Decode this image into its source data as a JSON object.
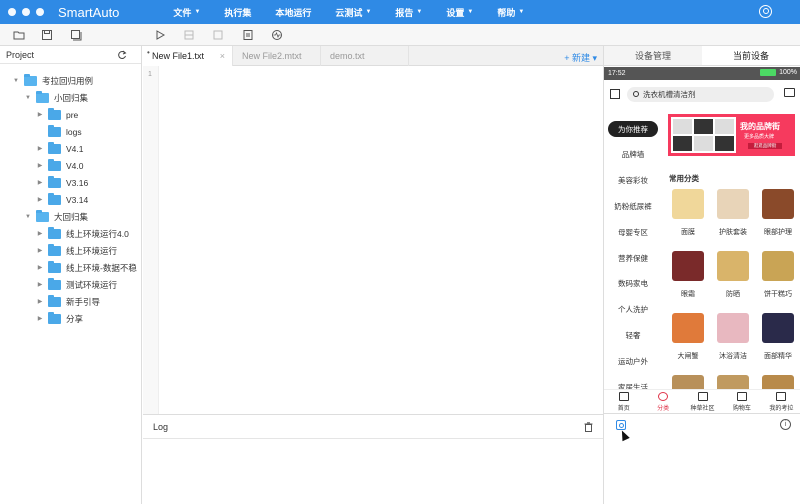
{
  "app": {
    "title": "SmartAuto"
  },
  "menu": [
    {
      "label": "文件",
      "caret": true
    },
    {
      "label": "执行集",
      "caret": false
    },
    {
      "label": "本地运行",
      "caret": false
    },
    {
      "label": "云测试",
      "caret": true
    },
    {
      "label": "报告",
      "caret": true
    },
    {
      "label": "设置",
      "caret": true
    },
    {
      "label": "帮助",
      "caret": true
    }
  ],
  "project": {
    "title": "Project",
    "tree": [
      {
        "label": "考拉回归用例",
        "depth": 0,
        "open": true
      },
      {
        "label": "小回归集",
        "depth": 1,
        "open": true
      },
      {
        "label": "pre",
        "depth": 2,
        "open": false
      },
      {
        "label": "logs",
        "depth": 2,
        "open": false,
        "leaf": true
      },
      {
        "label": "V4.1",
        "depth": 2,
        "open": false
      },
      {
        "label": "V4.0",
        "depth": 2,
        "open": false
      },
      {
        "label": "V3.16",
        "depth": 2,
        "open": false
      },
      {
        "label": "V3.14",
        "depth": 2,
        "open": false
      },
      {
        "label": "大回归集",
        "depth": 1,
        "open": true
      },
      {
        "label": "线上环境运行4.0",
        "depth": 2,
        "open": false
      },
      {
        "label": "线上环境运行",
        "depth": 2,
        "open": false
      },
      {
        "label": "线上环境-数据不稳",
        "depth": 2,
        "open": false
      },
      {
        "label": "测试环境运行",
        "depth": 2,
        "open": false
      },
      {
        "label": "新手引导",
        "depth": 2,
        "open": false
      },
      {
        "label": "分享",
        "depth": 2,
        "open": false
      }
    ]
  },
  "editor": {
    "tabs": [
      {
        "label": "New File1.txt",
        "active": true,
        "close": "×"
      },
      {
        "label": "New File2.mtxt",
        "active": false,
        "close": ""
      },
      {
        "label": "demo.txt",
        "active": false,
        "close": ""
      }
    ],
    "new_label": "+ 新建 ▾",
    "line_number": "1"
  },
  "log": {
    "title": "Log"
  },
  "device": {
    "tabs": [
      "设备管理",
      "当前设备"
    ],
    "status_time": "17:52",
    "battery_text": "100%",
    "search_text": "洗衣机槽清洁剂",
    "categories": [
      "为你推荐",
      "品牌墙",
      "美容彩妆",
      "奶粉纸尿裤",
      "母婴专区",
      "营养保健",
      "数码家电",
      "个人洗护",
      "轻奢",
      "运动户外",
      "家居生活"
    ],
    "banner": {
      "title": "我的品牌街",
      "subtitle": "更多品质大牌",
      "button": "逛逛品牌街"
    },
    "section_title": "常用分类",
    "products": [
      {
        "label": "面膜",
        "color": "#f0d79a"
      },
      {
        "label": "护肤套装",
        "color": "#e8d4b8"
      },
      {
        "label": "眼部护理",
        "color": "#8a4a2a"
      },
      {
        "label": "眼霜",
        "color": "#7a2a2a"
      },
      {
        "label": "防晒",
        "color": "#d9b46a"
      },
      {
        "label": "饼干糕巧",
        "color": "#c9a455"
      },
      {
        "label": "大闸蟹",
        "color": "#e07a3a"
      },
      {
        "label": "沐浴清洁",
        "color": "#e8b8c0"
      },
      {
        "label": "面部精华",
        "color": "#2a2a4a"
      },
      {
        "label": "",
        "color": "#b8905a"
      },
      {
        "label": "",
        "color": "#c09a60"
      },
      {
        "label": "",
        "color": "#b88a4a"
      }
    ],
    "bottom_nav": [
      {
        "label": "首页",
        "active": false
      },
      {
        "label": "分类",
        "active": true
      },
      {
        "label": "种草社区",
        "active": false
      },
      {
        "label": "购物车",
        "active": false
      },
      {
        "label": "我的考拉",
        "active": false
      }
    ]
  }
}
